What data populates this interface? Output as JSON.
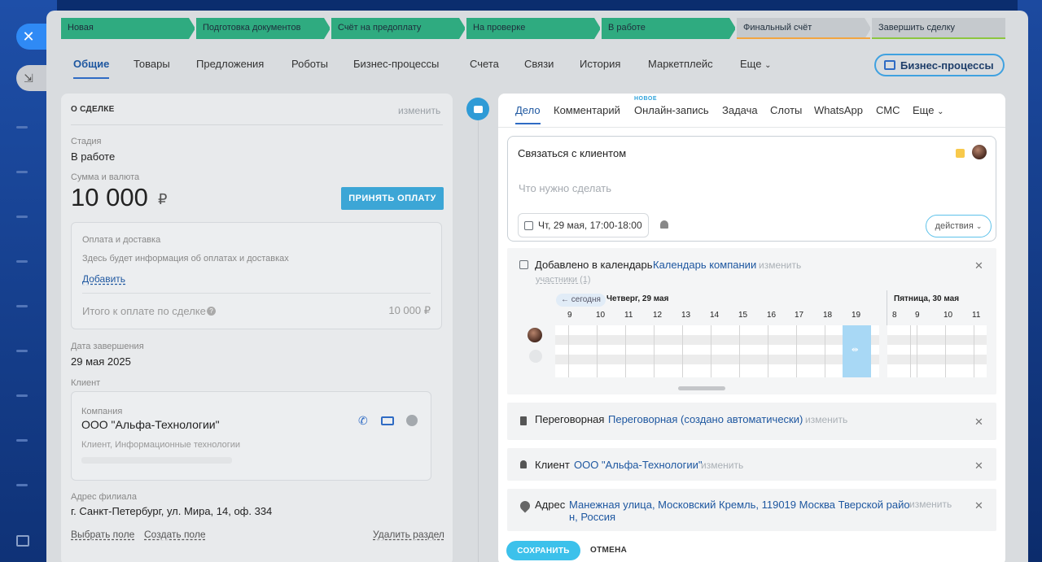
{
  "stages": [
    {
      "label": "Новая",
      "color": "#2fab80"
    },
    {
      "label": "Подготовка документов",
      "color": "#2fab80"
    },
    {
      "label": "Счёт на предоплату",
      "color": "#2fab80"
    },
    {
      "label": "На проверке",
      "color": "#2fab80"
    },
    {
      "label": "В работе",
      "color": "#2fab80"
    },
    {
      "label": "Финальный счёт",
      "color": "#c5c9cd",
      "underline": "#f2a541"
    },
    {
      "label": "Завершить сделку",
      "color": "#c5c9cd",
      "underline": "#8cc63f"
    }
  ],
  "tabs": {
    "t0": "Общие",
    "t1": "Товары",
    "t2": "Предложения",
    "t3": "Роботы",
    "t4": "Бизнес-процессы",
    "t5": "Счета",
    "t6": "Связи",
    "t7": "История",
    "t8": "Маркетплейс",
    "t9": "Еще"
  },
  "bp_button": "Бизнес-процессы",
  "deal": {
    "section_title": "О СДЕЛКЕ",
    "edit": "изменить",
    "stage_label": "Стадия",
    "stage_value": "В работе",
    "sum_label": "Сумма и валюта",
    "sum_value": "10 000",
    "currency": "₽",
    "pay_button": "ПРИНЯТЬ ОПЛАТУ",
    "payment_title": "Оплата и доставка",
    "payment_info": "Здесь будет информация об оплатах и доставках",
    "add": "Добавить",
    "total_label": "Итого к оплате по сделке",
    "total_value": "10 000 ₽",
    "close_label": "Дата завершения",
    "close_value": "29 мая 2025",
    "client_label": "Клиент",
    "company_label": "Компания",
    "company_name": "ООО \"Альфа-Технологии\"",
    "company_desc": "Клиент, Информационные технологии",
    "address_label": "Адрес филиала",
    "address_value": "г. Санкт-Петербург, ул. Мира, 14, оф. 334",
    "select_field": "Выбрать поле",
    "create_field": "Создать поле",
    "delete_section": "Удалить раздел"
  },
  "activity": {
    "new_badge": "НОВОЕ",
    "tabs": {
      "r0": "Дело",
      "r1": "Комментарий",
      "r2": "Онлайн-запись",
      "r3": "Задача",
      "r4": "Слоты",
      "r5": "WhatsApp",
      "r6": "СМС",
      "r7": "Еще"
    },
    "title": "Связаться с клиентом",
    "placeholder": "Что нужно сделать",
    "date": "Чт, 29 мая, 17:00-18:00",
    "actions": "действия",
    "cal_label": "Добавлено в календарь",
    "cal_link": "Календарь компании",
    "change": "изменить",
    "participants": "участники (1)",
    "today": "← сегодня",
    "day1": "Четверг, 29 мая",
    "day2": "Пятница, 30 мая",
    "hours1": [
      "9",
      "10",
      "11",
      "12",
      "13",
      "14",
      "15",
      "16",
      "17",
      "18",
      "19"
    ],
    "hours2": [
      "8",
      "9",
      "10",
      "11"
    ],
    "room_label": "Переговорная",
    "room_link": "Переговорная (создано автоматически)",
    "client_label": "Клиент",
    "client_link": "ООО \"Альфа-Технологии\"",
    "addr_label": "Адрес",
    "addr_line1": "Манежная улица, Московский Кремль, 119019 Москва Тверской райо",
    "addr_line2": "н, Россия",
    "save": "СОХРАНИТЬ",
    "cancel": "ОТМЕНА"
  },
  "icons": [
    "close-icon",
    "minimize-icon",
    "phone-icon",
    "mail-icon",
    "chat-icon",
    "calendar-icon",
    "bell-icon",
    "pin-icon",
    "user-icon",
    "room-icon",
    "printer-icon"
  ]
}
